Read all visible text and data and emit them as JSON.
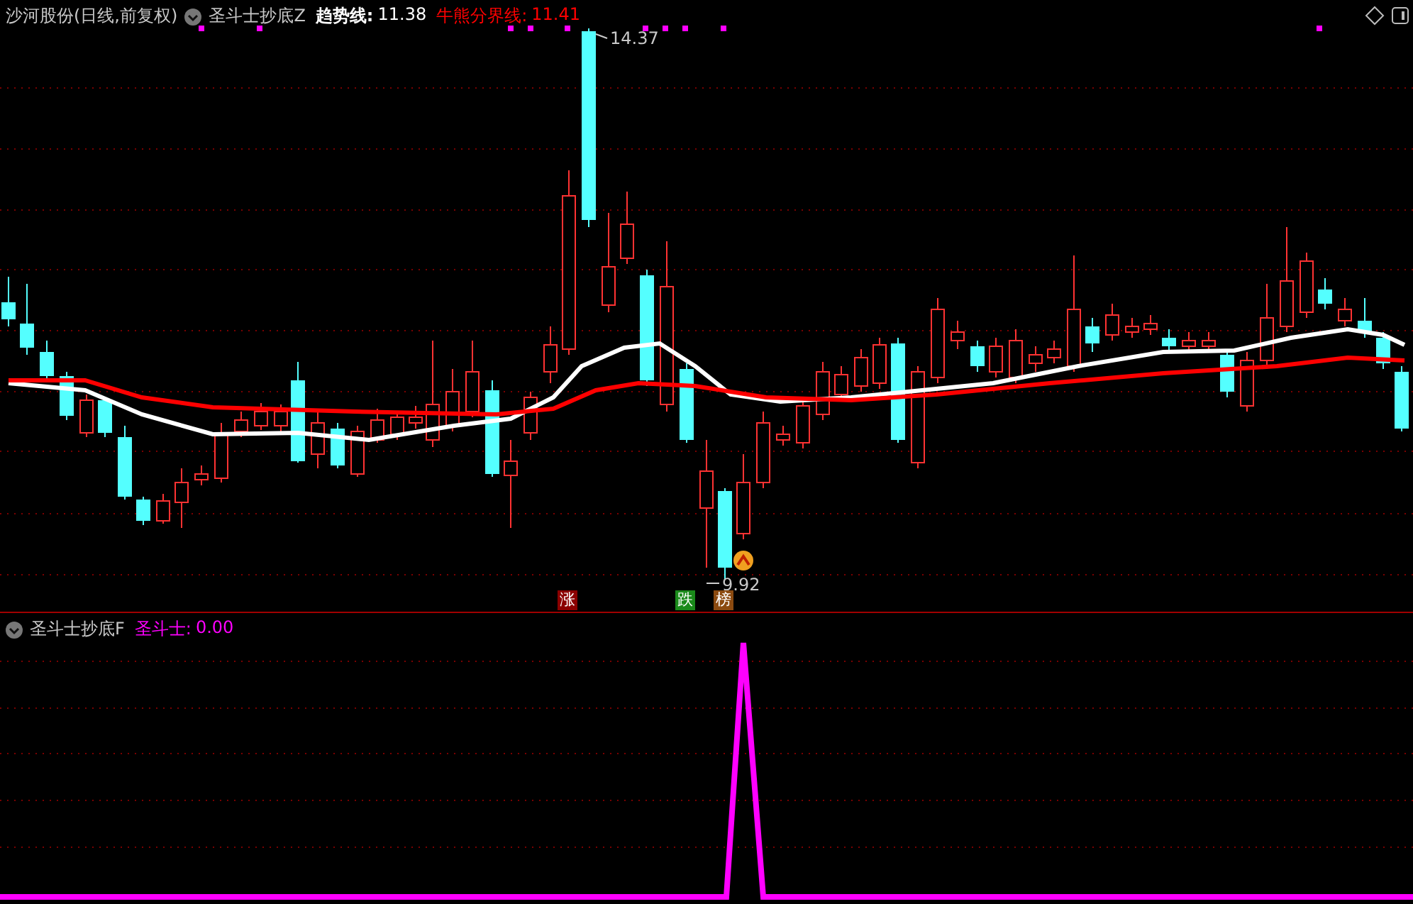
{
  "main_panel": {
    "title": "沙河股份(日线,前复权)",
    "indicator": "圣斗士抄底Z",
    "lines": [
      {
        "label": "趋势线:",
        "value": "11.38",
        "color": "#ffffff"
      },
      {
        "label": "牛熊分界线:",
        "value": "11.41",
        "color": "#ff0000"
      }
    ],
    "high_label": "14.37",
    "low_label": "9.92",
    "signals": [
      {
        "text": "涨",
        "color": "#8b0000"
      },
      {
        "text": "跌",
        "color": "#1a8a1a"
      },
      {
        "text": "榜",
        "color": "#8b4a10"
      }
    ]
  },
  "sub_panel": {
    "indicator": "圣斗士抄底F",
    "lines": [
      {
        "label": "圣斗士:",
        "value": "0.00",
        "color": "#ff00ff"
      }
    ]
  }
}
